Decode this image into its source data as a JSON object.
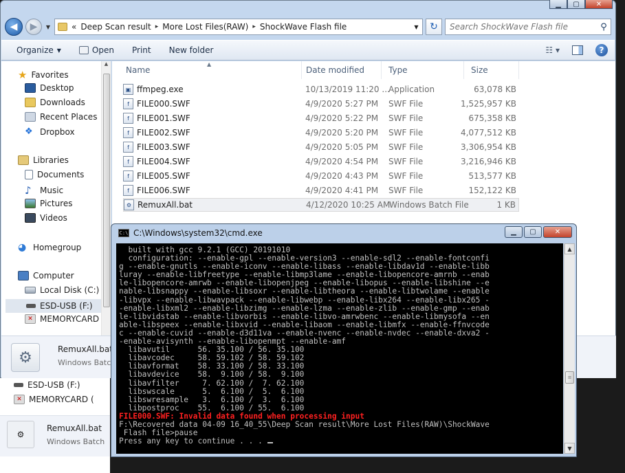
{
  "address": {
    "crumbs": [
      "«",
      "Deep Scan result",
      "More Lost Files(RAW)",
      "ShockWave Flash file"
    ],
    "search_placeholder": "Search ShockWave Flash file"
  },
  "toolbar": {
    "organize": "Organize",
    "open": "Open",
    "print": "Print",
    "new_folder": "New folder"
  },
  "sidebar": {
    "favorites": "Favorites",
    "desktop": "Desktop",
    "downloads": "Downloads",
    "recent_places": "Recent Places",
    "dropbox": "Dropbox",
    "libraries": "Libraries",
    "documents": "Documents",
    "music": "Music",
    "pictures": "Pictures",
    "videos": "Videos",
    "homegroup": "Homegroup",
    "computer": "Computer",
    "local_disk": "Local Disk (C:)",
    "esd_usb": "ESD-USB (F:)",
    "memorycard": "MEMORYCARD ("
  },
  "columns": {
    "name": "Name",
    "date": "Date modified",
    "type": "Type",
    "size": "Size"
  },
  "files": [
    {
      "name": "ffmpeg.exe",
      "date": "10/13/2019 11:20 ...",
      "type": "Application",
      "size": "63,078 KB"
    },
    {
      "name": "FILE000.SWF",
      "date": "4/9/2020 5:27 PM",
      "type": "SWF File",
      "size": "1,525,957 KB"
    },
    {
      "name": "FILE001.SWF",
      "date": "4/9/2020 5:22 PM",
      "type": "SWF File",
      "size": "675,358 KB"
    },
    {
      "name": "FILE002.SWF",
      "date": "4/9/2020 5:20 PM",
      "type": "SWF File",
      "size": "4,077,512 KB"
    },
    {
      "name": "FILE003.SWF",
      "date": "4/9/2020 5:05 PM",
      "type": "SWF File",
      "size": "3,306,954 KB"
    },
    {
      "name": "FILE004.SWF",
      "date": "4/9/2020 4:54 PM",
      "type": "SWF File",
      "size": "3,216,946 KB"
    },
    {
      "name": "FILE005.SWF",
      "date": "4/9/2020 4:43 PM",
      "type": "SWF File",
      "size": "513,577 KB"
    },
    {
      "name": "FILE006.SWF",
      "date": "4/9/2020 4:41 PM",
      "type": "SWF File",
      "size": "152,122 KB"
    },
    {
      "name": "RemuxAll.bat",
      "date": "4/12/2020 10:25 AM",
      "type": "Windows Batch File",
      "size": "1 KB"
    }
  ],
  "details": {
    "name": "RemuxAll.bat",
    "type": "Windows Batch"
  },
  "background_window": {
    "esd_usb": "ESD-USB (F:)",
    "memorycard": "MEMORYCARD (",
    "detail_name": "RemuxAll.bat",
    "detail_type": "Windows Batch"
  },
  "cmd": {
    "title": "C:\\Windows\\system32\\cmd.exe",
    "lines": [
      "  built with gcc 9.2.1 (GCC) 20191010",
      "  configuration: --enable-gpl --enable-version3 --enable-sdl2 --enable-fontconfi",
      "g --enable-gnutls --enable-iconv --enable-libass --enable-libdav1d --enable-libb",
      "luray --enable-libfreetype --enable-libmp3lame --enable-libopencore-amrnb --enab",
      "le-libopencore-amrwb --enable-libopenjpeg --enable-libopus --enable-libshine --e",
      "nable-libsnappy --enable-libsoxr --enable-libtheora --enable-libtwolame --enable",
      "-libvpx --enable-libwavpack --enable-libwebp --enable-libx264 --enable-libx265 -",
      "-enable-libxml2 --enable-libzimg --enable-lzma --enable-zlib --enable-gmp --enab",
      "le-libvidstab --enable-libvorbis --enable-libvo-amrwbenc --enable-libmysofa --en",
      "able-libspeex --enable-libxvid --enable-libaom --enable-libmfx --enable-ffnvcode",
      "c --enable-cuvid --enable-d3d11va --enable-nvenc --enable-nvdec --enable-dxva2 -",
      "-enable-avisynth --enable-libopenmpt --enable-amf",
      "  libavutil      56. 35.100 / 56. 35.100",
      "  libavcodec     58. 59.102 / 58. 59.102",
      "  libavformat    58. 33.100 / 58. 33.100",
      "  libavdevice    58.  9.100 / 58.  9.100",
      "  libavfilter     7. 62.100 /  7. 62.100",
      "  libswscale      5.  6.100 /  5.  6.100",
      "  libswresample   3.  6.100 /  3.  6.100",
      "  libpostproc    55.  6.100 / 55.  6.100"
    ],
    "error_line": "FILE000.SWF: Invalid data found when processing input",
    "prompt_lines": [
      "",
      "F:\\Recovered data 04-09 16_40_55\\Deep Scan result\\More Lost Files(RAW)\\ShockWave",
      " Flash file>pause",
      "Press any key to continue . . . "
    ]
  }
}
